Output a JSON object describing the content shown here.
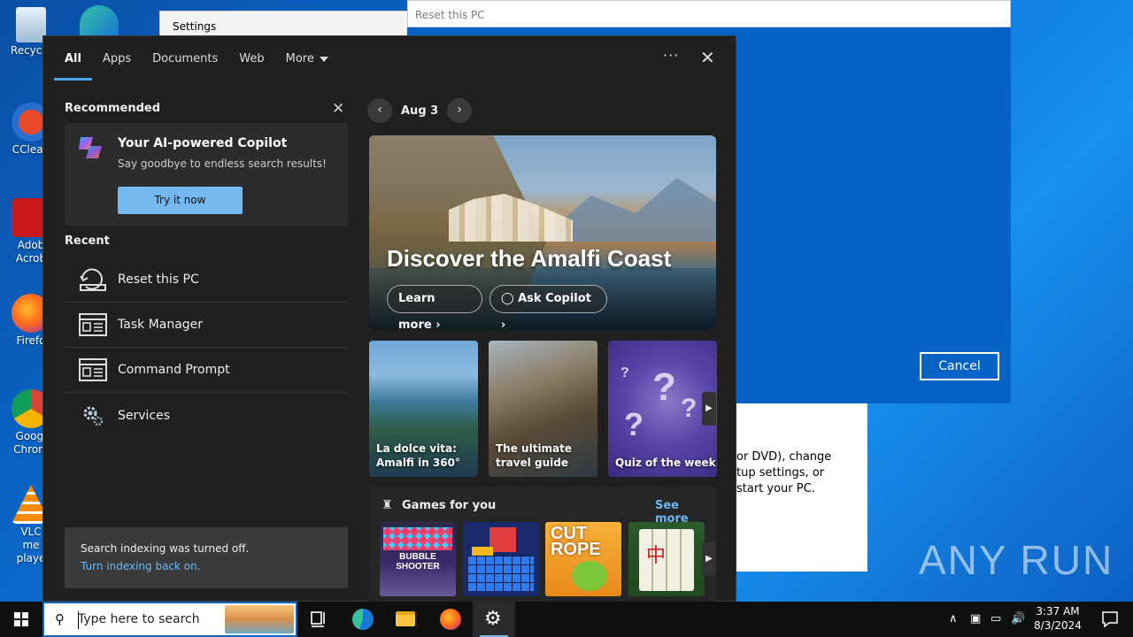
{
  "desktop": {
    "icons": [
      {
        "label": "Recycle"
      },
      {
        "label": "CClean"
      },
      {
        "label": "Adob Acrob"
      },
      {
        "label": "Firefo"
      },
      {
        "label": "Googl Chrom"
      },
      {
        "label": "VLC me playe"
      }
    ]
  },
  "settings_window": {
    "title": "Settings"
  },
  "reset_window": {
    "title": "Reset this PC",
    "cancel_label": "Cancel",
    "partial_text": [
      "or DVD), change",
      "tup settings, or",
      "start your PC."
    ]
  },
  "watermark": "ANY RUN",
  "search": {
    "tabs": [
      "All",
      "Apps",
      "Documents",
      "Web",
      "More"
    ],
    "more_options_label": "···",
    "close_label": "✕",
    "recommended": {
      "heading": "Recommended",
      "card_title": "Your AI-powered Copilot",
      "card_subtitle": "Say goodbye to endless search results!",
      "card_button": "Try it now"
    },
    "recent": {
      "heading": "Recent",
      "items": [
        {
          "label": "Reset this PC",
          "icon": "reset-pc-icon"
        },
        {
          "label": "Task Manager",
          "icon": "window-icon"
        },
        {
          "label": "Command Prompt",
          "icon": "window-icon"
        },
        {
          "label": "Services",
          "icon": "gears-icon"
        }
      ]
    },
    "indexing": {
      "line1": "Search indexing was turned off.",
      "line2": "Turn indexing back on."
    },
    "highlights": {
      "date": "Aug 3",
      "hero_title": "Discover the Amalfi Coast",
      "learn_more": "Learn more",
      "ask_copilot": "Ask Copilot",
      "tiles": [
        {
          "title": "La dolce vita: Amalfi in 360°"
        },
        {
          "title": "The ultimate travel guide"
        },
        {
          "title": "Quiz of the week"
        }
      ],
      "games_heading": "Games for you",
      "see_more": "See more"
    }
  },
  "taskbar": {
    "search_placeholder": "Type here to search",
    "time": "3:37 AM",
    "date": "8/3/2024"
  },
  "colors": {
    "accent": "#4ca8f0",
    "link": "#6cb8f6",
    "flyout_bg": "#202020",
    "desktop": "#0b6fd4"
  }
}
